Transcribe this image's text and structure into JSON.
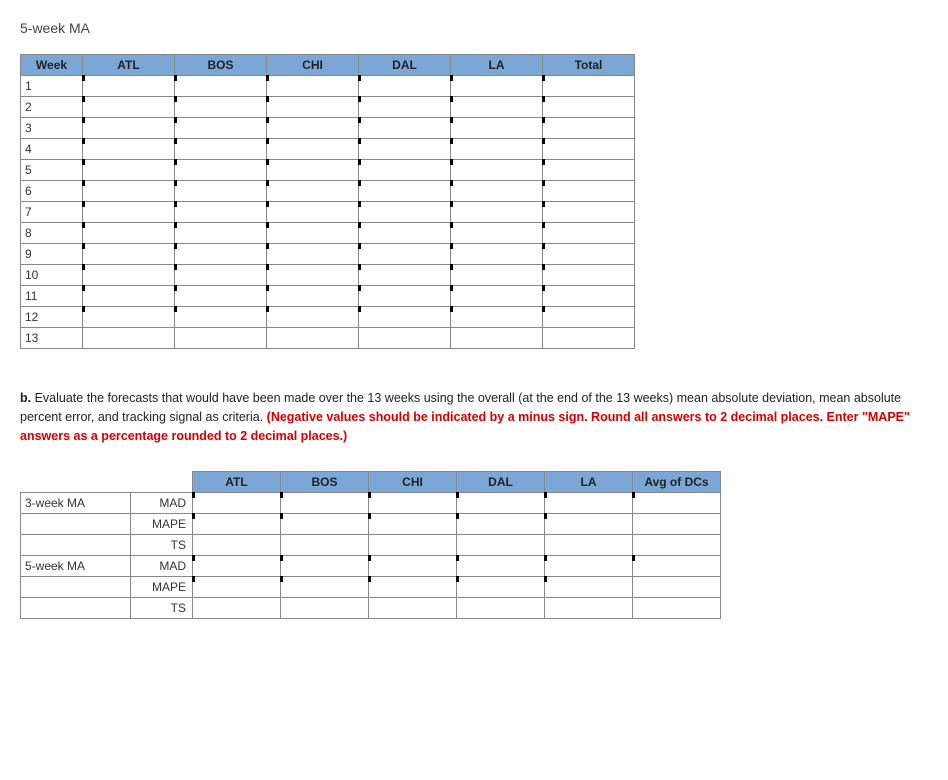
{
  "title_top": "5-week MA",
  "table1": {
    "headers": [
      "Week",
      "ATL",
      "BOS",
      "CHI",
      "DAL",
      "LA",
      "Total"
    ],
    "weeks": [
      "1",
      "2",
      "3",
      "4",
      "5",
      "6",
      "7",
      "8",
      "9",
      "10",
      "11",
      "12",
      "13"
    ]
  },
  "instruction": {
    "prefix_bold": "b.",
    "body1": " Evaluate the forecasts that would have been made over the 13 weeks using the overall (at the end of the 13 weeks) mean absolute deviation, mean absolute percent error, and tracking signal as criteria. ",
    "red": "(Negative values should be indicated by a minus sign. Round all answers to 2 decimal places. Enter \"MAPE\" answers as a percentage rounded to 2 decimal places.)"
  },
  "table2": {
    "headers": [
      "",
      "",
      "ATL",
      "BOS",
      "CHI",
      "DAL",
      "LA",
      "Avg of DCs"
    ],
    "groups": [
      {
        "label": "3-week MA",
        "metrics": [
          "MAD",
          "MAPE",
          "TS"
        ]
      },
      {
        "label": "5-week MA",
        "metrics": [
          "MAD",
          "MAPE",
          "TS"
        ]
      }
    ]
  }
}
